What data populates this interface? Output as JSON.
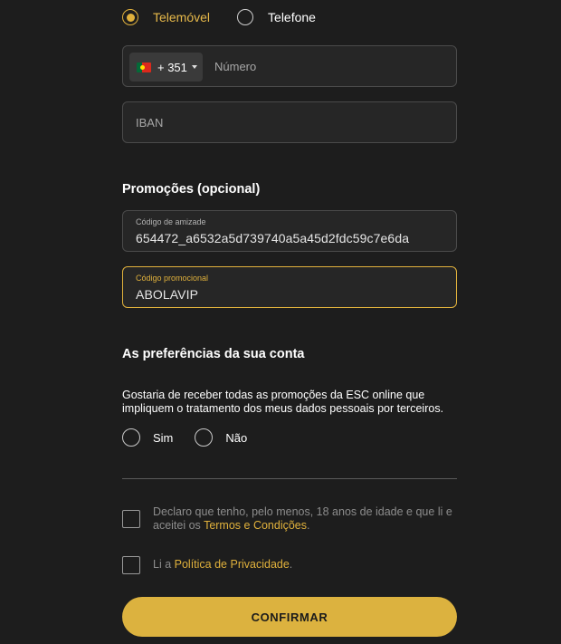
{
  "phone_type": {
    "options": [
      {
        "label": "Telemóvel",
        "selected": true
      },
      {
        "label": "Telefone",
        "selected": false
      }
    ]
  },
  "phone": {
    "country_code": "+ 351",
    "country_flag": "portugal-flag",
    "placeholder": "Número",
    "value": ""
  },
  "iban": {
    "placeholder": "IBAN",
    "value": ""
  },
  "promotions": {
    "title": "Promoções (opcional)",
    "friend_code": {
      "label": "Código de amizade",
      "value": "654472_a6532a5d739740a5a45d2fdc59c7e6da"
    },
    "promo_code": {
      "label": "Código promocional",
      "value": "ABOLAVIP"
    }
  },
  "preferences": {
    "title": "As preferências da sua conta",
    "consent_text": "Gostaria de receber todas as promoções da ESC online que impliquem o tratamento dos meus dados pessoais por terceiros.",
    "yes_label": "Sim",
    "no_label": "Não"
  },
  "agreements": {
    "age_text": "Declaro que tenho, pelo menos, 18 anos de idade e que li e aceitei os",
    "terms_link": "Termos e Condições",
    "age_suffix": ".",
    "privacy_prefix": "Li a",
    "privacy_link": "Política de Privacidade",
    "privacy_suffix": "."
  },
  "confirm_label": "CONFIRMAR",
  "colors": {
    "accent": "#dcb23f",
    "background": "#1d1d1d",
    "field_bg": "#262626"
  }
}
